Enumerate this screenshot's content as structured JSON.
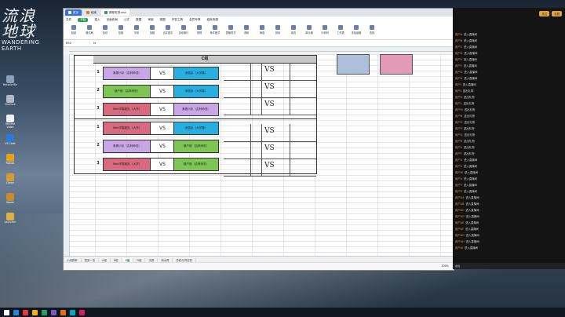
{
  "desktop": {
    "sysinfo": [
      "",
      "",
      ""
    ],
    "logo_cn": "流浪地球",
    "logo_en": [
      "WANDERING",
      "EARTH"
    ],
    "icons": [
      {
        "label": "Recycle Bin",
        "color": "#8aa0b8"
      },
      {
        "label": "Shortcut",
        "color": "#b0b8c8"
      },
      {
        "label": "Tencent Video",
        "color": "#f0f0f0"
      },
      {
        "label": "VS Code",
        "color": "#2b7ad8"
      },
      {
        "label": "Roblox",
        "color": "#e4a020"
      },
      {
        "label": "Game",
        "color": "#d59a30"
      },
      {
        "label": "Steam",
        "color": "#c88a2a"
      },
      {
        "label": "Launcher",
        "color": "#e0b040"
      }
    ]
  },
  "window": {
    "tabs": [
      {
        "label": "首页",
        "kind": "home"
      },
      {
        "label": "稻壳",
        "kind": "normal"
      },
      {
        "label": "赛程安排.xlsx",
        "kind": "active"
      }
    ],
    "menu": [
      "文件",
      "开始",
      "插入",
      "页面布局",
      "公式",
      "数据",
      "审阅",
      "视图",
      "开发工具",
      "会员专享",
      "稻壳资源"
    ],
    "menu_active": "开始",
    "ribbon": [
      "粘贴",
      "格式刷",
      "剪切",
      "复制",
      "字体",
      "加粗",
      "合并居中",
      "自动换行",
      "常规",
      "条件格式",
      "表格样式",
      "求和",
      "筛选",
      "排序",
      "填充",
      "单元格",
      "行和列",
      "工作表",
      "冻结窗格",
      "查找"
    ],
    "cell_ref": "B52",
    "formula": "fx",
    "group_title": "C组",
    "vs_label": "VS",
    "blocks": [
      {
        "matches": [
          {
            "num": "1",
            "left": "奥德小队（吉林师范）",
            "left_color": "#c9a6e6",
            "right": "深蓝队（大学路）",
            "right_color": "#29aee0"
          },
          {
            "num": "2",
            "left": "猎户座（吉林师范）",
            "left_color": "#7dc653",
            "right": "深蓝队（大学路）",
            "right_color": "#29aee0"
          },
          {
            "num": "3",
            "left": "Web学霸团队（大学）",
            "left_color": "#d76a7e",
            "right": "奥德小队（吉林师范）",
            "right_color": "#c9a6e6"
          }
        ]
      },
      {
        "matches": [
          {
            "num": "1",
            "left": "Web学霸团队（大学）",
            "left_color": "#d76a7e",
            "right": "深蓝队（大学路）",
            "right_color": "#29aee0"
          },
          {
            "num": "2",
            "left": "奥德小队（吉林师范）",
            "left_color": "#c9a6e6",
            "right": "猎户座（吉林师范）",
            "right_color": "#7dc653"
          },
          {
            "num": "3",
            "left": "Web学霸团队（大学）",
            "left_color": "#d76a7e",
            "right": "猎户座（吉林师范）",
            "right_color": "#7dc653"
          }
        ]
      }
    ],
    "swatches": [
      "#aebfdc",
      "#e39ab4"
    ],
    "sheet_tabs": [
      "小组赛单",
      "签到一览",
      "A组",
      "B组",
      "C组",
      "D组",
      "决赛",
      "淘汰赛",
      "总积分排名表"
    ],
    "active_sheet": "C组",
    "status": "100%"
  },
  "chat": {
    "pills": [
      "关注",
      "礼物"
    ],
    "lines": [
      {
        "user": "用户A",
        "text": "进入直播间"
      },
      {
        "user": "用户B",
        "text": "进入直播间"
      },
      {
        "user": "用户C",
        "text": "进入直播间"
      },
      {
        "user": "用户D",
        "text": "进入直播间"
      },
      {
        "user": "用户E",
        "text": "进入直播间"
      },
      {
        "user": "用户F",
        "text": "进入直播间"
      },
      {
        "user": "用户G",
        "text": "进入直播间"
      },
      {
        "user": "用户H",
        "text": "进入直播间"
      },
      {
        "user": "用户I",
        "text": "进入直播间"
      },
      {
        "user": "用户J",
        "text": "送出礼物"
      },
      {
        "user": "用户K",
        "text": "送出礼物"
      },
      {
        "user": "用户L",
        "text": "送出礼物"
      },
      {
        "user": "用户M",
        "text": "送出礼物"
      },
      {
        "user": "用户N",
        "text": "送出礼物"
      },
      {
        "user": "用户O",
        "text": "送出礼物"
      },
      {
        "user": "用户P",
        "text": "送出礼物"
      },
      {
        "user": "用户Q",
        "text": "送出礼物"
      },
      {
        "user": "用户R",
        "text": "送出礼物"
      },
      {
        "user": "用户S",
        "text": "送出礼物"
      },
      {
        "user": "用户T",
        "text": "送出礼物"
      },
      {
        "user": "用户U",
        "text": "进入直播间"
      },
      {
        "user": "用户V",
        "text": "进入直播间"
      },
      {
        "user": "用户W",
        "text": "进入直播间"
      },
      {
        "user": "用户X",
        "text": "进入直播间"
      },
      {
        "user": "用户Y",
        "text": "进入直播间"
      },
      {
        "user": "用户Z",
        "text": "进入直播间"
      },
      {
        "user": "用户AA",
        "text": "进入直播间"
      },
      {
        "user": "用户AB",
        "text": "进入直播间"
      },
      {
        "user": "用户AC",
        "text": "进入直播间"
      },
      {
        "user": "用户AD",
        "text": "进入直播间"
      },
      {
        "user": "用户AE",
        "text": "进入直播间"
      },
      {
        "user": "用户AF",
        "text": "进入直播间"
      },
      {
        "user": "用户AG",
        "text": "进入直播间"
      },
      {
        "user": "用户AH",
        "text": "进入直播间"
      },
      {
        "user": "用户AI",
        "text": "进入直播间"
      }
    ],
    "footer": "在线"
  },
  "taskbar": {
    "icons": [
      "#1e88e5",
      "#e53935",
      "#f4b400",
      "#1aa260",
      "#7e57c2",
      "#ef6c00",
      "#00acc1",
      "#d81b60"
    ],
    "time": "",
    "date": ""
  }
}
